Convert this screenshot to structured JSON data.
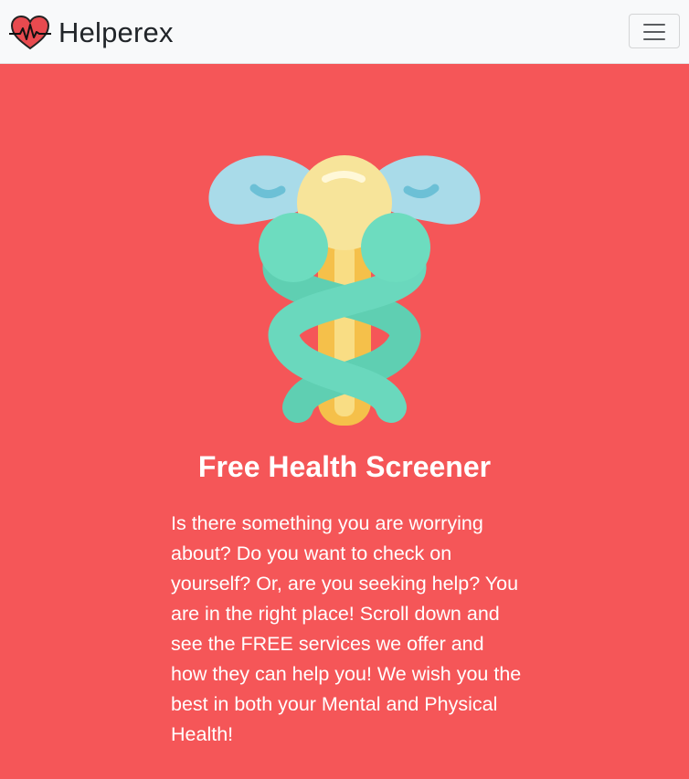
{
  "navbar": {
    "brand_name": "Helperex",
    "brand_icon": "heart-pulse-icon",
    "toggle_icon": "hamburger-menu-icon"
  },
  "hero": {
    "image": "caduceus-icon",
    "title": "Free Health Screener",
    "description": "Is there something you are worrying about? Do you want to check on yourself? Or, are you seeking help? You are in the right place! Scroll down and see the FREE services we offer and how they can help you! We wish you the best in both your Mental and Physical Health!"
  },
  "colors": {
    "background": "#f55658",
    "navbar": "#f8f9fa",
    "heart": "#e53935"
  }
}
